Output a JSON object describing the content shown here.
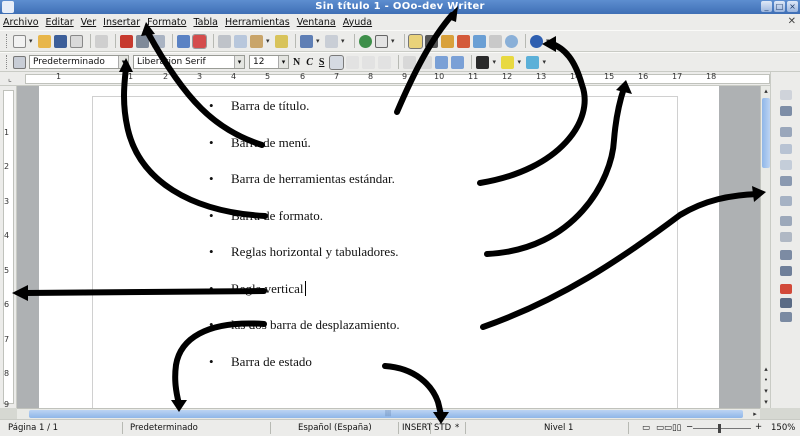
{
  "window": {
    "title": "Sin título 1 - OOo-dev Writer",
    "controls": [
      "_",
      "□",
      "×"
    ]
  },
  "menu": [
    "Archivo",
    "Editar",
    "Ver",
    "Insertar",
    "Formato",
    "Tabla",
    "Herramientas",
    "Ventana",
    "Ayuda"
  ],
  "formatting": {
    "style": "Predeterminado",
    "font": "Liberation Serif",
    "size": "12",
    "bold": "N",
    "italic": "C",
    "underline": "S"
  },
  "ruler": {
    "h_numbers": [
      "1",
      "1",
      "2",
      "3",
      "4",
      "5",
      "6",
      "7",
      "8",
      "9",
      "10",
      "11",
      "12",
      "13",
      "14",
      "15",
      "16",
      "17",
      "18"
    ],
    "v_numbers": [
      "1",
      "2",
      "3",
      "4",
      "5",
      "6",
      "7",
      "8",
      "9"
    ]
  },
  "document": {
    "bullets": [
      "Barra de título.",
      "Barra de menú.",
      "Barra de herramientas estándar.",
      "Barra de formato.",
      "Reglas horizontal y tabuladores.",
      "Regla vertical",
      "las dos barra de desplazamiento.",
      "Barra de estado"
    ]
  },
  "statusbar": {
    "page": "Página  1 / 1",
    "style": "Predeterminado",
    "language": "Español (España)",
    "insert_mode": "INSERT",
    "selection_mode": "STD",
    "modified": "*",
    "level": "Nivel  1",
    "zoom": "150%"
  },
  "colors": {
    "titlebar": "#4a7bc0",
    "chrome": "#ececea",
    "doc_bg": "#aeb1b3",
    "arrow": "#000000",
    "scroll_thumb": "#9fc0ec"
  }
}
